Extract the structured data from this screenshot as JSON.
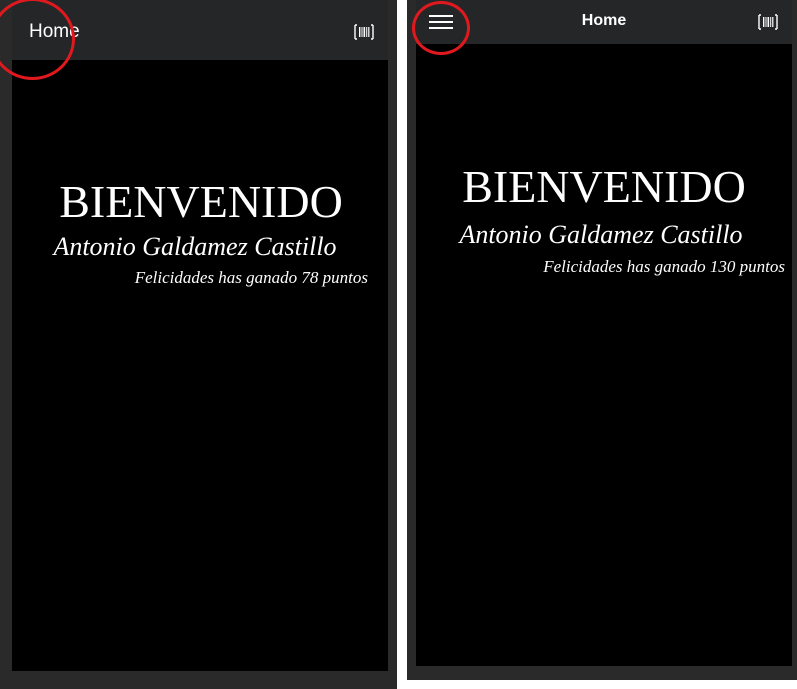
{
  "screens": [
    {
      "appbar": {
        "title": "Home"
      },
      "main": {
        "welcome": "BIENVENIDO",
        "user_name": "Antonio Galdamez Castillo",
        "points_message": "Felicidades has ganado 78 puntos"
      }
    },
    {
      "appbar": {
        "title": "Home"
      },
      "main": {
        "welcome": "BIENVENIDO",
        "user_name": "Antonio Galdamez Castillo",
        "points_message": "Felicidades has ganado 130 puntos"
      }
    }
  ],
  "icons": {
    "scan": "barcode-scan-icon",
    "menu": "hamburger-menu-icon"
  },
  "colors": {
    "appbar": "#252628",
    "background": "#000000",
    "text": "#ffffff",
    "annotation": "#e0191f",
    "frame": "#2a2a2a"
  }
}
